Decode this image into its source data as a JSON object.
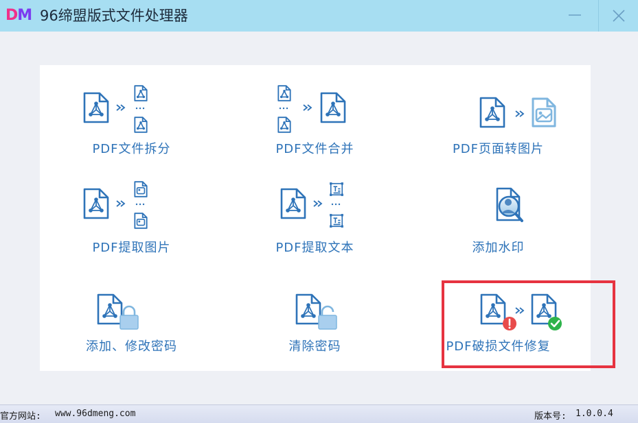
{
  "app": {
    "logo_d": "D",
    "logo_m": "M",
    "title": "96缔盟版式文件处理器"
  },
  "tools": [
    {
      "label": "PDF文件拆分"
    },
    {
      "label": "PDF文件合并"
    },
    {
      "label": "PDF页面转图片"
    },
    {
      "label": "PDF提取图片"
    },
    {
      "label": "PDF提取文本"
    },
    {
      "label": "添加水印"
    },
    {
      "label": "添加、修改密码"
    },
    {
      "label": "清除密码"
    },
    {
      "label": "PDF破损文件修复"
    }
  ],
  "status": {
    "website_label": "官方网站:",
    "website_url": "www.96dmeng.com",
    "version_label": "版本号:",
    "version": "1.0.0.4"
  },
  "colors": {
    "titlebar": "#a7def2",
    "accent": "#2e73b8",
    "highlight": "#e63340",
    "error": "#e84b4b",
    "success": "#2db34a"
  }
}
